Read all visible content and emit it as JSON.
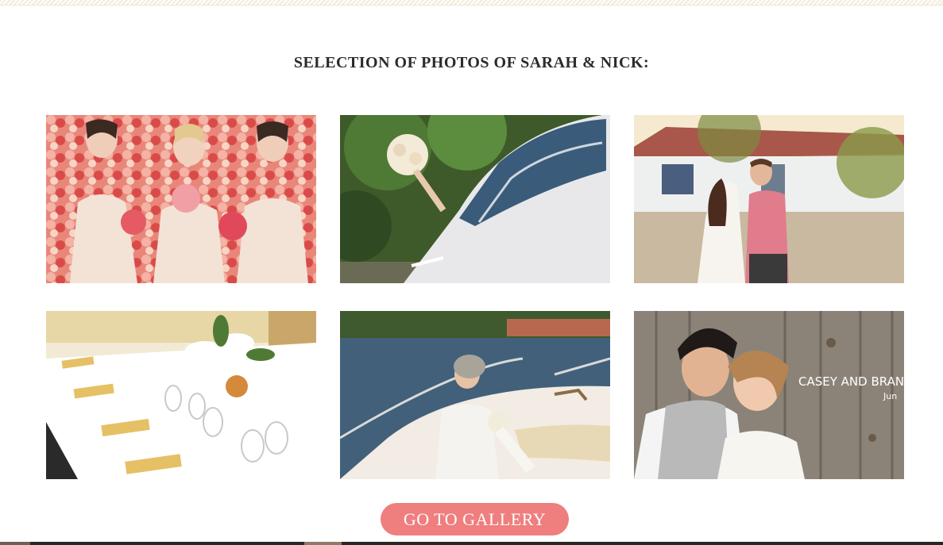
{
  "section": {
    "title": "SELECTION OF PHOTOS OF SARAH & NICK:"
  },
  "photos": [
    {
      "alt": "Bridesmaids with bouquets in front of a wall of roses"
    },
    {
      "alt": "Bride's bouquet held out of a white car window"
    },
    {
      "alt": "Couple kissing in a sunlit courtyard"
    },
    {
      "alt": "Banquet table set with napkins, glasses and lily centerpiece"
    },
    {
      "alt": "Bride with bouquet sitting on the bow of a boat"
    },
    {
      "alt": "Couple posing against a weathered wooden fence",
      "caption": "CASEY AND BRAN",
      "caption_sub": "Jun"
    }
  ],
  "cta": {
    "label": "GO TO GALLERY",
    "color": "#ef7e7e"
  }
}
